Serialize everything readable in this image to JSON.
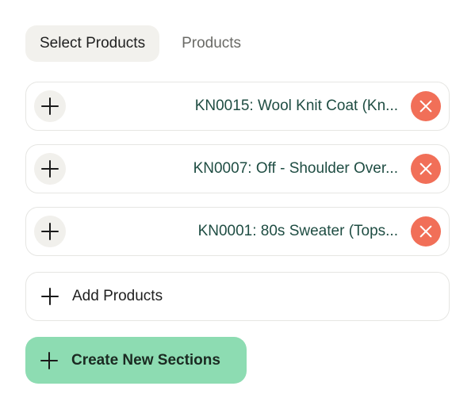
{
  "tabs": [
    {
      "label": "Select Products",
      "active": true
    },
    {
      "label": "Products",
      "active": false
    }
  ],
  "products": [
    {
      "label": "KN0015: Wool Knit Coat (Kn..."
    },
    {
      "label": "KN0007: Off - Shoulder Over..."
    },
    {
      "label": "KN0001: 80s Sweater (Tops..."
    }
  ],
  "add_products_label": "Add Products",
  "create_sections_label": "Create New Sections",
  "colors": {
    "product_text": "#1f4d43",
    "remove_button": "#f16f58",
    "create_button": "#8ddcb2"
  },
  "icons": {
    "add": "plus-icon",
    "remove": "close-icon"
  }
}
